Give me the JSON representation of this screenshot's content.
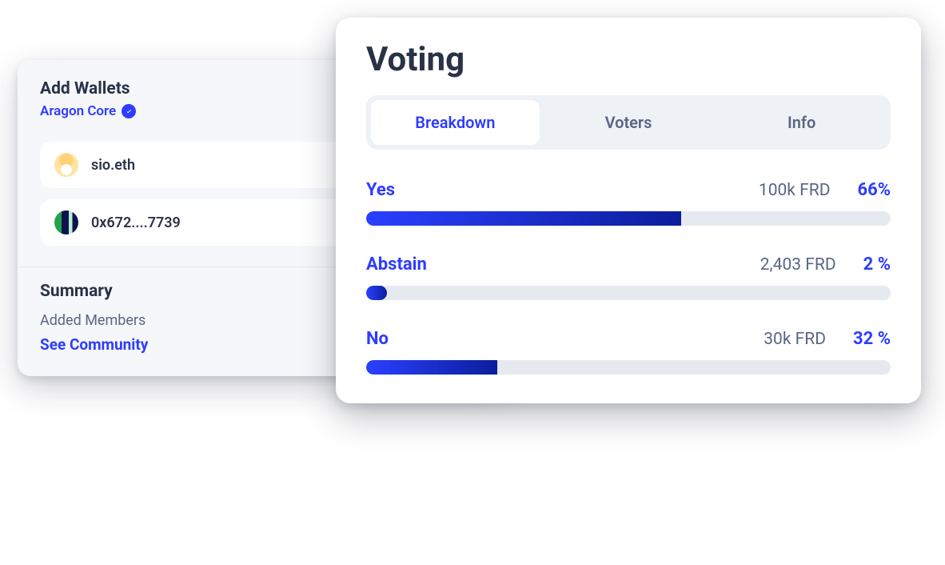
{
  "wallets": {
    "title": "Add Wallets",
    "org": "Aragon Core",
    "items": [
      {
        "label": "sio.eth"
      },
      {
        "label": "0x672....7739"
      }
    ],
    "summary_title": "Summary",
    "added_members": "Added Members",
    "see_community": "See Community"
  },
  "voting": {
    "title": "Voting",
    "tabs": [
      {
        "label": "Breakdown",
        "active": true
      },
      {
        "label": "Voters",
        "active": false
      },
      {
        "label": "Info",
        "active": false
      }
    ],
    "rows": [
      {
        "label": "Yes",
        "amount": "100k FRD",
        "pct": "66%",
        "fill": 60
      },
      {
        "label": "Abstain",
        "amount": "2,403 FRD",
        "pct": "2 %",
        "fill": 4
      },
      {
        "label": "No",
        "amount": "30k FRD",
        "pct": "32 %",
        "fill": 25
      }
    ]
  }
}
